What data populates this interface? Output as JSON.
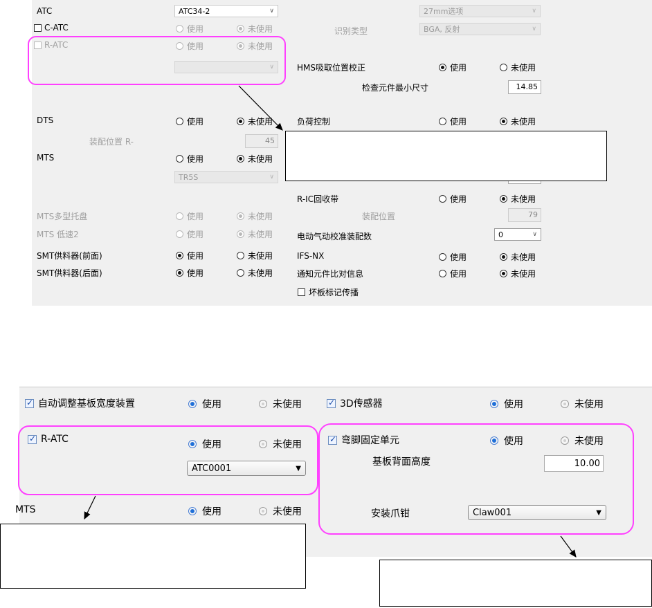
{
  "top_panel": {
    "atc": {
      "label": "ATC",
      "combo_value": "ATC34-2"
    },
    "c_atc": {
      "label": "C-ATC",
      "use": "使用",
      "not_use": "未使用"
    },
    "r_atc": {
      "label": "R-ATC",
      "use": "使用",
      "not_use": "未使用"
    },
    "recog": {
      "option_combo": "27mm选项",
      "label": "识别类型",
      "type_combo": "BGA, 反射"
    },
    "hms": {
      "label": "HMS吸取位置校正",
      "use": "使用",
      "not_use": "未使用"
    },
    "min_size": {
      "label": "检查元件最小尺寸",
      "value": "14.85"
    },
    "dts": {
      "label": "DTS",
      "use": "使用",
      "not_use": "未使用"
    },
    "mount_r": {
      "label": "装配位置 R-",
      "value": "45"
    },
    "load": {
      "label": "负荷控制",
      "use": "使用",
      "not_use": "未使用"
    },
    "mts": {
      "label": "MTS",
      "use": "使用",
      "not_use": "未使用",
      "combo_value": "TR5S"
    },
    "ric": {
      "label": "R-IC回收带",
      "use": "使用",
      "not_use": "未使用"
    },
    "ric_pos": {
      "label": "装配位置",
      "value": "79"
    },
    "mts_multi": {
      "label": "MTS多型托盘",
      "use": "使用",
      "not_use": "未使用"
    },
    "mts_low": {
      "label": "MTS 低速2",
      "use": "使用",
      "not_use": "未使用"
    },
    "elec": {
      "label": "电动气动校准装配数",
      "value": "0"
    },
    "smt_front": {
      "label": "SMT供料器(前面)",
      "use": "使用",
      "not_use": "未使用"
    },
    "ifs": {
      "label": "IFS-NX",
      "use": "使用",
      "not_use": "未使用"
    },
    "smt_rear": {
      "label": "SMT供料器(后面)",
      "use": "使用",
      "not_use": "未使用"
    },
    "notify": {
      "label": "通知元件比对信息",
      "use": "使用",
      "not_use": "未使用"
    },
    "bad_mark": {
      "label": "坏板标记传播"
    }
  },
  "bottom_panel": {
    "auto_width": {
      "label": "自动调整基板宽度装置",
      "use": "使用",
      "not_use": "未使用"
    },
    "sensor3d": {
      "label": "3D传感器",
      "use": "使用",
      "not_use": "未使用"
    },
    "r_atc": {
      "label": "R-ATC",
      "use": "使用",
      "not_use": "未使用",
      "combo_value": "ATC0001"
    },
    "clinch": {
      "label": "弯脚固定单元",
      "use": "使用",
      "not_use": "未使用"
    },
    "back_height": {
      "label": "基板背面高度",
      "value": "10.00"
    },
    "mts": {
      "label": "MTS",
      "use": "使用",
      "not_use": "未使用"
    },
    "claw": {
      "label": "安装爪钳",
      "combo_value": "Claw001"
    }
  },
  "colors": {
    "highlight": "#ff40ff",
    "panel_bg": "#f0f0f0",
    "radio_selected": "#1f6fd8"
  }
}
